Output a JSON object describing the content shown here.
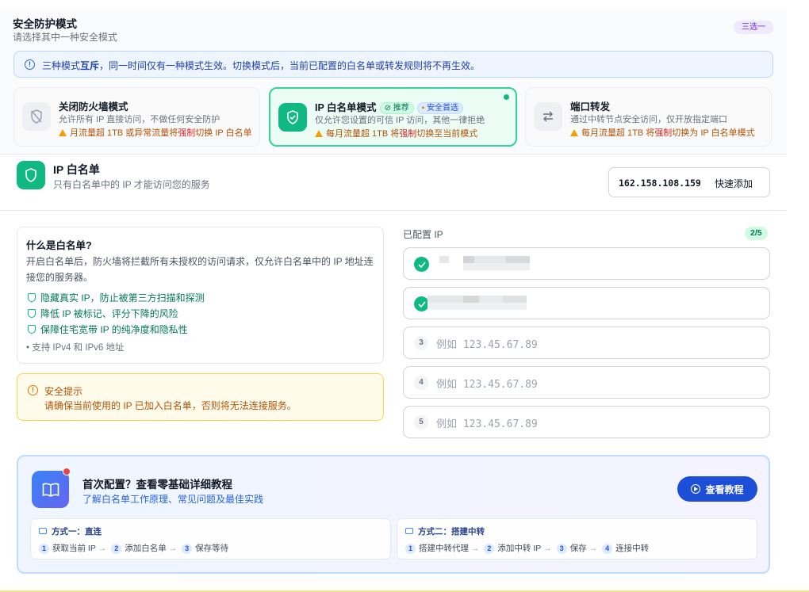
{
  "section": {
    "title": "安全防护模式",
    "subtitle": "请选择其中一种安全模式",
    "badge": "三选一"
  },
  "banner": {
    "text_a": "三种模式",
    "text_b": "互斥",
    "text_c": "，同一时间仅有一种模式生效。切换模式后，当前已配置的白名单或转发规则将不再生效。"
  },
  "modes": [
    {
      "title": "关闭防火墙模式",
      "desc": "允许所有 IP 直接访问，不做任何安全防护",
      "warn_a": "月流量超 1TB 或异常流量将",
      "warn_red": "强制",
      "warn_b": "切换 IP 白名单",
      "icon": "shield-off-icon"
    },
    {
      "title": "IP 白名单模式",
      "tag_recommend": "推荐",
      "tag_security": "安全首选",
      "desc": "仅允许您设置的可信 IP 访问，其他一律拒绝",
      "warn_a": "每月流量超 1TB 将",
      "warn_red": "强制",
      "warn_b": "切换至当前模式",
      "icon": "shield-check-icon"
    },
    {
      "title": "端口转发",
      "desc": "通过中转节点安全访问，仅开放指定端口",
      "warn_a": "每月流量超 1TB 将",
      "warn_red": "强制",
      "warn_b": "切换为 IP 白名单模式",
      "icon": "swap-arrows-icon"
    }
  ],
  "whitelist": {
    "title": "IP 白名单",
    "subtitle": "只有白名单中的 IP 才能访问您的服务",
    "current_ip": "162.158.108.159",
    "quick_add": "快速添加"
  },
  "what": {
    "question": "什么是白名单?",
    "paragraph": "开启白名单后，防火墙将拦截所有未授权的访问请求，仅允许白名单中的 IP 地址连接您的服务器。",
    "benefits": [
      "隐藏真实 IP，防止被第三方扫描和探测",
      "降低 IP 被标记、评分下降的风险",
      "保障住宅宽带 IP 的纯净度和隐私性"
    ],
    "footnote": "• 支持 IPv4 和 IPv6 地址"
  },
  "tip": {
    "title": "安全提示",
    "text": "请确保当前使用的 IP 已加入白名单，否则将无法连接服务。"
  },
  "configured": {
    "label": "已配置 IP",
    "count": "2/5",
    "placeholder_cn": "例如",
    "placeholder_ip": "123.45.67.89",
    "rows": [
      {
        "status": "filled"
      },
      {
        "status": "filled"
      },
      {
        "status": "empty",
        "num": "3"
      },
      {
        "status": "empty",
        "num": "4"
      },
      {
        "status": "empty",
        "num": "5"
      }
    ]
  },
  "tutorial": {
    "title": "首次配置？查看零基础详细教程",
    "subtitle": "了解白名单工作原理、常见问题及最佳实践",
    "button": "查看教程",
    "method1": {
      "title": "方式一：直连",
      "steps": [
        "获取当前 IP",
        "添加白名单",
        "保存等待"
      ]
    },
    "method2": {
      "title": "方式二：搭建中转",
      "steps": [
        "搭建中转代理",
        "添加中转 IP",
        "保存",
        "连接中转"
      ]
    }
  },
  "colors": {
    "accent_green": "#10b981",
    "accent_blue": "#1d4ed8",
    "warn": "#b45309",
    "danger": "#dc2626"
  }
}
